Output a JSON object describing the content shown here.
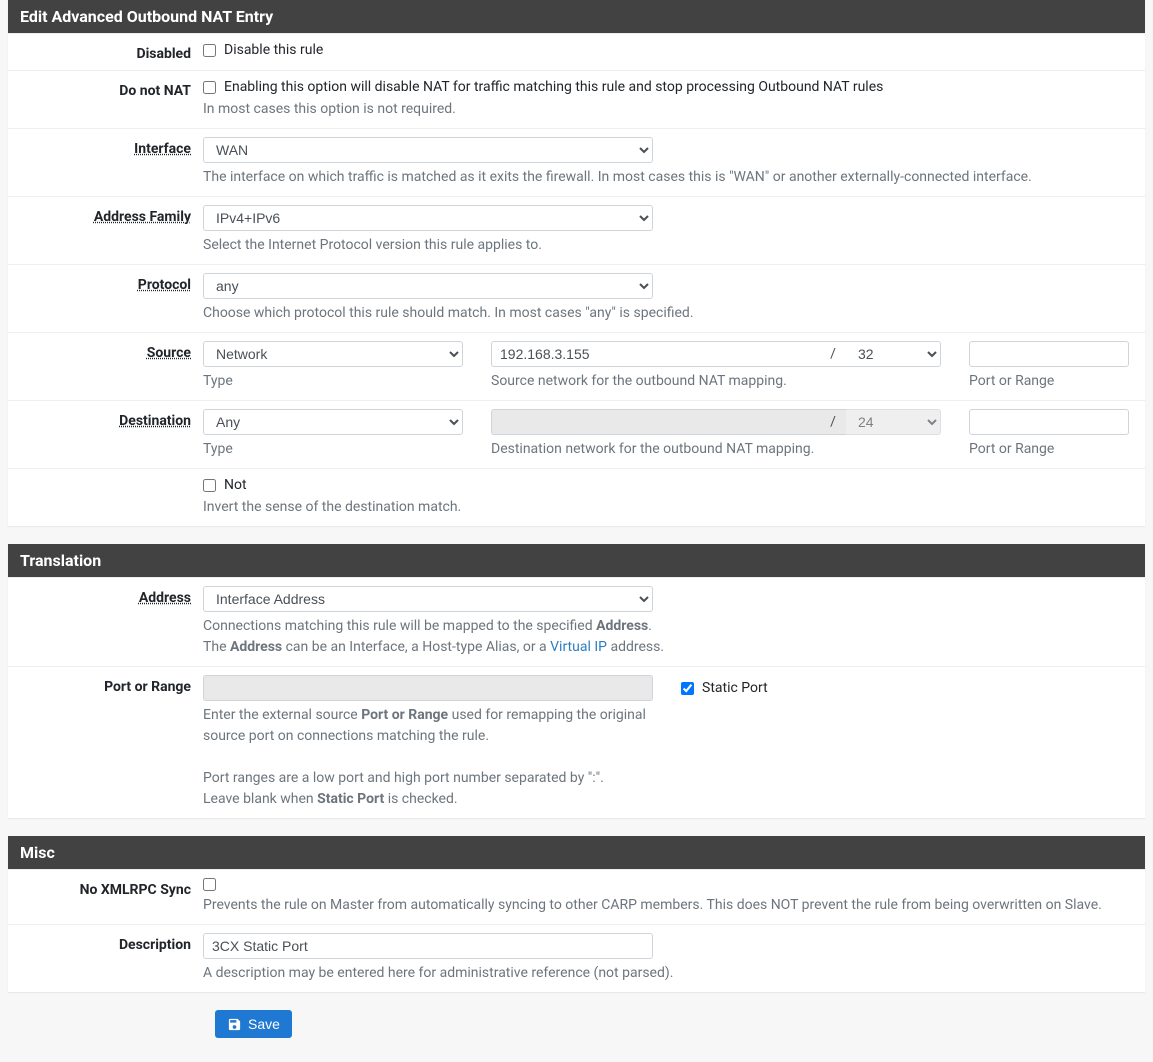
{
  "panels": {
    "edit": {
      "title": "Edit Advanced Outbound NAT Entry"
    },
    "translation": {
      "title": "Translation"
    },
    "misc": {
      "title": "Misc"
    }
  },
  "disabled": {
    "label": "Disabled",
    "checkbox_label": "Disable this rule",
    "checked": false
  },
  "donotnat": {
    "label": "Do not NAT",
    "checkbox_label": "Enabling this option will disable NAT for traffic matching this rule and stop processing Outbound NAT rules",
    "checked": false,
    "help": "In most cases this option is not required."
  },
  "interface": {
    "label": "Interface",
    "value": "WAN",
    "help": "The interface on which traffic is matched as it exits the firewall. In most cases this is \"WAN\" or another externally-connected interface."
  },
  "addressfamily": {
    "label": "Address Family",
    "value": "IPv4+IPv6",
    "help": "Select the Internet Protocol version this rule applies to."
  },
  "protocol": {
    "label": "Protocol",
    "value": "any",
    "help": "Choose which protocol this rule should match. In most cases \"any\" is specified."
  },
  "source": {
    "label": "Source",
    "type_value": "Network",
    "network": "192.168.3.155",
    "mask": "32",
    "port": "",
    "type_caption": "Type",
    "net_caption": "Source network for the outbound NAT mapping.",
    "port_caption": "Port or Range"
  },
  "destination": {
    "label": "Destination",
    "type_value": "Any",
    "network": "",
    "mask": "24",
    "port": "",
    "type_caption": "Type",
    "net_caption": "Destination network for the outbound NAT mapping.",
    "port_caption": "Port or Range"
  },
  "not": {
    "checkbox_label": "Not",
    "checked": false,
    "help": "Invert the sense of the destination match."
  },
  "trans_address": {
    "label": "Address",
    "value": "Interface Address",
    "help_pre": "Connections matching this rule will be mapped to the specified ",
    "help_bold1": "Address",
    "help_mid1": ".",
    "help_line2_pre": "The ",
    "help_line2_bold": "Address",
    "help_line2_mid": " can be an Interface, a Host-type Alias, or a ",
    "help_line2_link": "Virtual IP",
    "help_line2_post": " address."
  },
  "trans_port": {
    "label": "Port or Range",
    "value": "",
    "static_checked": true,
    "static_label": "Static Port",
    "help1_pre": "Enter the external source ",
    "help1_bold": "Port or Range",
    "help1_post": " used for remapping the original source port on connections matching the rule.",
    "help2": "Port ranges are a low port and high port number separated by \":\".",
    "help3_pre": "Leave blank when ",
    "help3_bold": "Static Port",
    "help3_post": " is checked."
  },
  "nosync": {
    "label": "No XMLRPC Sync",
    "checked": false,
    "help": "Prevents the rule on Master from automatically syncing to other CARP members. This does NOT prevent the rule from being overwritten on Slave."
  },
  "description": {
    "label": "Description",
    "value": "3CX Static Port",
    "help": "A description may be entered here for administrative reference (not parsed)."
  },
  "save_label": "Save",
  "slash": "/"
}
